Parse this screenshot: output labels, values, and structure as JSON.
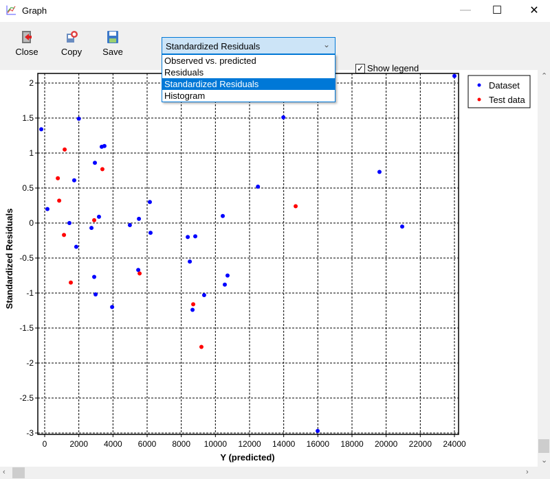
{
  "window": {
    "title": "Graph",
    "minimize": "—",
    "maximize": "☐",
    "close": "✕"
  },
  "toolbar": {
    "close_label": "Close",
    "copy_label": "Copy",
    "save_label": "Save",
    "view_select": {
      "selected": "Standardized Residuals",
      "options": [
        "Observed vs. predicted",
        "Residuals",
        "Standardized Residuals",
        "Histogram"
      ]
    },
    "show_legend_label": "Show legend",
    "show_legend_checked": true
  },
  "chart_data": {
    "type": "scatter",
    "xlabel": "Y (predicted)",
    "ylabel": "Standardized Residuals",
    "xlim": [
      -400,
      24300
    ],
    "ylim": [
      -3,
      2.2
    ],
    "xticks": [
      0,
      2000,
      4000,
      6000,
      8000,
      10000,
      12000,
      14000,
      16000,
      18000,
      20000,
      22000,
      24000
    ],
    "yticks": [
      -3,
      -2.5,
      -2,
      -1.5,
      -1,
      -0.5,
      0,
      0.5,
      1,
      1.5,
      2
    ],
    "grid": true,
    "legend": "top-right",
    "series": [
      {
        "name": "Dataset",
        "color": "#0000ff",
        "points": [
          [
            -200,
            1.34
          ],
          [
            160,
            0.2
          ],
          [
            2000,
            1.49
          ],
          [
            1730,
            0.61
          ],
          [
            1450,
            0
          ],
          [
            1850,
            -0.34
          ],
          [
            2940,
            0.86
          ],
          [
            3340,
            1.09
          ],
          [
            3500,
            1.1
          ],
          [
            3180,
            0.09
          ],
          [
            2740,
            -0.07
          ],
          [
            2900,
            -0.77
          ],
          [
            2980,
            -1.02
          ],
          [
            3950,
            -1.2
          ],
          [
            4990,
            -0.03
          ],
          [
            5520,
            0.06
          ],
          [
            6160,
            0.3
          ],
          [
            6200,
            -0.14
          ],
          [
            5480,
            -0.67
          ],
          [
            8380,
            -0.2
          ],
          [
            8820,
            -0.19
          ],
          [
            8500,
            -0.55
          ],
          [
            8660,
            -1.24
          ],
          [
            9340,
            -1.03
          ],
          [
            10430,
            0.1
          ],
          [
            10550,
            -0.88
          ],
          [
            10710,
            -0.75
          ],
          [
            12490,
            0.52
          ],
          [
            13980,
            1.51
          ],
          [
            19610,
            0.73
          ],
          [
            20940,
            -0.05
          ],
          [
            15990,
            -2.97
          ],
          [
            24000,
            2.1
          ]
        ]
      },
      {
        "name": "Test data",
        "color": "#ff0000",
        "points": [
          [
            1170,
            1.05
          ],
          [
            770,
            0.64
          ],
          [
            850,
            0.32
          ],
          [
            1130,
            -0.17
          ],
          [
            1530,
            -0.85
          ],
          [
            2900,
            0.04
          ],
          [
            3380,
            0.77
          ],
          [
            5560,
            -0.72
          ],
          [
            8700,
            -1.16
          ],
          [
            9180,
            -1.77
          ],
          [
            14700,
            0.24
          ]
        ]
      }
    ]
  }
}
